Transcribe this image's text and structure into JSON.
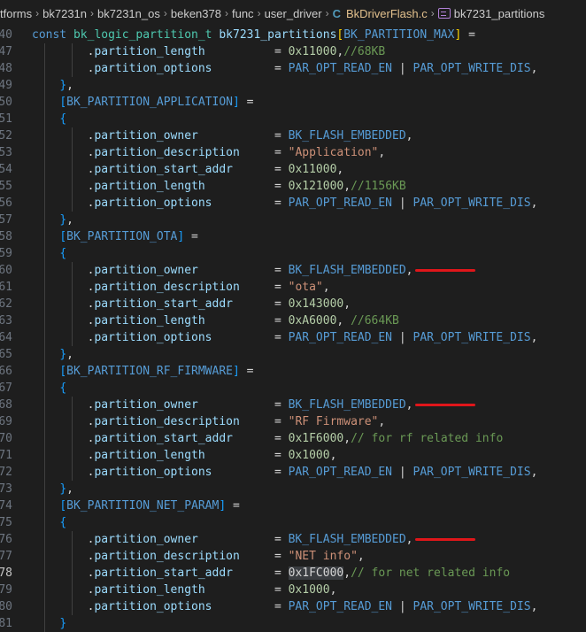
{
  "breadcrumb": {
    "items": [
      "tforms",
      "bk7231n",
      "bk7231n_os",
      "beken378",
      "func",
      "user_driver"
    ],
    "file_icon": "C",
    "file": "BkDriverFlash.c",
    "symbol": "bk7231_partitions"
  },
  "lines": [
    {
      "n": "40",
      "t": [
        [
          "kw",
          "const "
        ],
        [
          "type",
          "bk_logic_partition_t "
        ],
        [
          "ident",
          "bk7231_partitions"
        ],
        [
          "bracket2",
          "["
        ],
        [
          "macro",
          "BK_PARTITION_MAX"
        ],
        [
          "bracket2",
          "]"
        ],
        [
          "punc",
          " ="
        ]
      ]
    },
    {
      "n": "47",
      "t": [
        [
          "punc",
          "        ."
        ],
        [
          "ident",
          "partition_length"
        ],
        [
          "punc",
          "          = "
        ],
        [
          "num",
          "0x11000"
        ],
        [
          "punc",
          ","
        ],
        [
          "cm",
          "//68KB"
        ]
      ]
    },
    {
      "n": "48",
      "t": [
        [
          "punc",
          "        ."
        ],
        [
          "ident",
          "partition_options"
        ],
        [
          "punc",
          "         = "
        ],
        [
          "macro",
          "PAR_OPT_READ_EN"
        ],
        [
          "punc",
          " | "
        ],
        [
          "macro",
          "PAR_OPT_WRITE_DIS"
        ],
        [
          "punc",
          ","
        ]
      ]
    },
    {
      "n": "49",
      "t": [
        [
          "punc",
          "    "
        ],
        [
          "bracket3",
          "}"
        ],
        [
          "punc",
          ","
        ]
      ]
    },
    {
      "n": "50",
      "t": [
        [
          "punc",
          "    "
        ],
        [
          "bracket3",
          "["
        ],
        [
          "macro",
          "BK_PARTITION_APPLICATION"
        ],
        [
          "bracket3",
          "]"
        ],
        [
          "punc",
          " ="
        ]
      ]
    },
    {
      "n": "51",
      "t": [
        [
          "punc",
          "    "
        ],
        [
          "bracket3",
          "{"
        ]
      ]
    },
    {
      "n": "52",
      "t": [
        [
          "punc",
          "        ."
        ],
        [
          "ident",
          "partition_owner"
        ],
        [
          "punc",
          "           = "
        ],
        [
          "macro",
          "BK_FLASH_EMBEDDED"
        ],
        [
          "punc",
          ","
        ]
      ]
    },
    {
      "n": "53",
      "t": [
        [
          "punc",
          "        ."
        ],
        [
          "ident",
          "partition_description"
        ],
        [
          "punc",
          "     = "
        ],
        [
          "str",
          "\"Application\""
        ],
        [
          "punc",
          ","
        ]
      ]
    },
    {
      "n": "54",
      "t": [
        [
          "punc",
          "        ."
        ],
        [
          "ident",
          "partition_start_addr"
        ],
        [
          "punc",
          "      = "
        ],
        [
          "num",
          "0x11000"
        ],
        [
          "punc",
          ","
        ]
      ]
    },
    {
      "n": "55",
      "t": [
        [
          "punc",
          "        ."
        ],
        [
          "ident",
          "partition_length"
        ],
        [
          "punc",
          "          = "
        ],
        [
          "num",
          "0x121000"
        ],
        [
          "punc",
          ","
        ],
        [
          "cm",
          "//1156KB"
        ]
      ]
    },
    {
      "n": "56",
      "t": [
        [
          "punc",
          "        ."
        ],
        [
          "ident",
          "partition_options"
        ],
        [
          "punc",
          "         = "
        ],
        [
          "macro",
          "PAR_OPT_READ_EN"
        ],
        [
          "punc",
          " | "
        ],
        [
          "macro",
          "PAR_OPT_WRITE_DIS"
        ],
        [
          "punc",
          ","
        ]
      ]
    },
    {
      "n": "57",
      "t": [
        [
          "punc",
          "    "
        ],
        [
          "bracket3",
          "}"
        ],
        [
          "punc",
          ","
        ]
      ]
    },
    {
      "n": "58",
      "t": [
        [
          "punc",
          "    "
        ],
        [
          "bracket3",
          "["
        ],
        [
          "macro",
          "BK_PARTITION_OTA"
        ],
        [
          "bracket3",
          "]"
        ],
        [
          "punc",
          " ="
        ]
      ]
    },
    {
      "n": "59",
      "t": [
        [
          "punc",
          "    "
        ],
        [
          "bracket3",
          "{"
        ]
      ]
    },
    {
      "n": "60",
      "t": [
        [
          "punc",
          "        ."
        ],
        [
          "ident",
          "partition_owner"
        ],
        [
          "punc",
          "           = "
        ],
        [
          "macro",
          "BK_FLASH_EMBEDDED"
        ],
        [
          "punc",
          ","
        ]
      ],
      "mark": true
    },
    {
      "n": "61",
      "t": [
        [
          "punc",
          "        ."
        ],
        [
          "ident",
          "partition_description"
        ],
        [
          "punc",
          "     = "
        ],
        [
          "str",
          "\"ota\""
        ],
        [
          "punc",
          ","
        ]
      ]
    },
    {
      "n": "62",
      "t": [
        [
          "punc",
          "        ."
        ],
        [
          "ident",
          "partition_start_addr"
        ],
        [
          "punc",
          "      = "
        ],
        [
          "num",
          "0x143000"
        ],
        [
          "punc",
          ","
        ]
      ]
    },
    {
      "n": "63",
      "t": [
        [
          "punc",
          "        ."
        ],
        [
          "ident",
          "partition_length"
        ],
        [
          "punc",
          "          = "
        ],
        [
          "num",
          "0xA6000"
        ],
        [
          "punc",
          ", "
        ],
        [
          "cm",
          "//664KB"
        ]
      ]
    },
    {
      "n": "64",
      "t": [
        [
          "punc",
          "        ."
        ],
        [
          "ident",
          "partition_options"
        ],
        [
          "punc",
          "         = "
        ],
        [
          "macro",
          "PAR_OPT_READ_EN"
        ],
        [
          "punc",
          " | "
        ],
        [
          "macro",
          "PAR_OPT_WRITE_DIS"
        ],
        [
          "punc",
          ","
        ]
      ]
    },
    {
      "n": "65",
      "t": [
        [
          "punc",
          "    "
        ],
        [
          "bracket3",
          "}"
        ],
        [
          "punc",
          ","
        ]
      ]
    },
    {
      "n": "66",
      "t": [
        [
          "punc",
          "    "
        ],
        [
          "bracket3",
          "["
        ],
        [
          "macro",
          "BK_PARTITION_RF_FIRMWARE"
        ],
        [
          "bracket3",
          "]"
        ],
        [
          "punc",
          " ="
        ]
      ]
    },
    {
      "n": "67",
      "t": [
        [
          "punc",
          "    "
        ],
        [
          "bracket3",
          "{"
        ]
      ]
    },
    {
      "n": "68",
      "t": [
        [
          "punc",
          "        ."
        ],
        [
          "ident",
          "partition_owner"
        ],
        [
          "punc",
          "           = "
        ],
        [
          "macro",
          "BK_FLASH_EMBEDDED"
        ],
        [
          "punc",
          ","
        ]
      ],
      "mark": true
    },
    {
      "n": "69",
      "t": [
        [
          "punc",
          "        ."
        ],
        [
          "ident",
          "partition_description"
        ],
        [
          "punc",
          "     = "
        ],
        [
          "str",
          "\"RF Firmware\""
        ],
        [
          "punc",
          ","
        ]
      ]
    },
    {
      "n": "70",
      "t": [
        [
          "punc",
          "        ."
        ],
        [
          "ident",
          "partition_start_addr"
        ],
        [
          "punc",
          "      = "
        ],
        [
          "num",
          "0x1F6000"
        ],
        [
          "punc",
          ","
        ],
        [
          "cm",
          "// for rf related info"
        ]
      ]
    },
    {
      "n": "71",
      "t": [
        [
          "punc",
          "        ."
        ],
        [
          "ident",
          "partition_length"
        ],
        [
          "punc",
          "          = "
        ],
        [
          "num",
          "0x1000"
        ],
        [
          "punc",
          ","
        ]
      ]
    },
    {
      "n": "72",
      "t": [
        [
          "punc",
          "        ."
        ],
        [
          "ident",
          "partition_options"
        ],
        [
          "punc",
          "         = "
        ],
        [
          "macro",
          "PAR_OPT_READ_EN"
        ],
        [
          "punc",
          " | "
        ],
        [
          "macro",
          "PAR_OPT_WRITE_DIS"
        ],
        [
          "punc",
          ","
        ]
      ]
    },
    {
      "n": "73",
      "t": [
        [
          "punc",
          "    "
        ],
        [
          "bracket3",
          "}"
        ],
        [
          "punc",
          ","
        ]
      ]
    },
    {
      "n": "74",
      "t": [
        [
          "punc",
          "    "
        ],
        [
          "bracket3",
          "["
        ],
        [
          "macro",
          "BK_PARTITION_NET_PARAM"
        ],
        [
          "bracket3",
          "]"
        ],
        [
          "punc",
          " ="
        ]
      ]
    },
    {
      "n": "75",
      "t": [
        [
          "punc",
          "    "
        ],
        [
          "bracket3",
          "{"
        ]
      ]
    },
    {
      "n": "76",
      "t": [
        [
          "punc",
          "        ."
        ],
        [
          "ident",
          "partition_owner"
        ],
        [
          "punc",
          "           = "
        ],
        [
          "macro",
          "BK_FLASH_EMBEDDED"
        ],
        [
          "punc",
          ","
        ]
      ],
      "mark": true
    },
    {
      "n": "77",
      "t": [
        [
          "punc",
          "        ."
        ],
        [
          "ident",
          "partition_description"
        ],
        [
          "punc",
          "     = "
        ],
        [
          "str",
          "\"NET info\""
        ],
        [
          "punc",
          ","
        ]
      ]
    },
    {
      "n": "78",
      "t": [
        [
          "punc",
          "        ."
        ],
        [
          "ident",
          "partition_start_addr"
        ],
        [
          "punc",
          "      = "
        ],
        [
          "hl",
          "0x1FC000"
        ],
        [
          "punc",
          ","
        ],
        [
          "cm",
          "// for net related info"
        ]
      ],
      "active": true
    },
    {
      "n": "79",
      "t": [
        [
          "punc",
          "        ."
        ],
        [
          "ident",
          "partition_length"
        ],
        [
          "punc",
          "          = "
        ],
        [
          "num",
          "0x1000"
        ],
        [
          "punc",
          ","
        ]
      ]
    },
    {
      "n": "80",
      "t": [
        [
          "punc",
          "        ."
        ],
        [
          "ident",
          "partition_options"
        ],
        [
          "punc",
          "         = "
        ],
        [
          "macro",
          "PAR_OPT_READ_EN"
        ],
        [
          "punc",
          " | "
        ],
        [
          "macro",
          "PAR_OPT_WRITE_DIS"
        ],
        [
          "punc",
          ","
        ]
      ]
    },
    {
      "n": "81",
      "t": [
        [
          "punc",
          "    "
        ],
        [
          "bracket3",
          "}"
        ]
      ]
    }
  ]
}
